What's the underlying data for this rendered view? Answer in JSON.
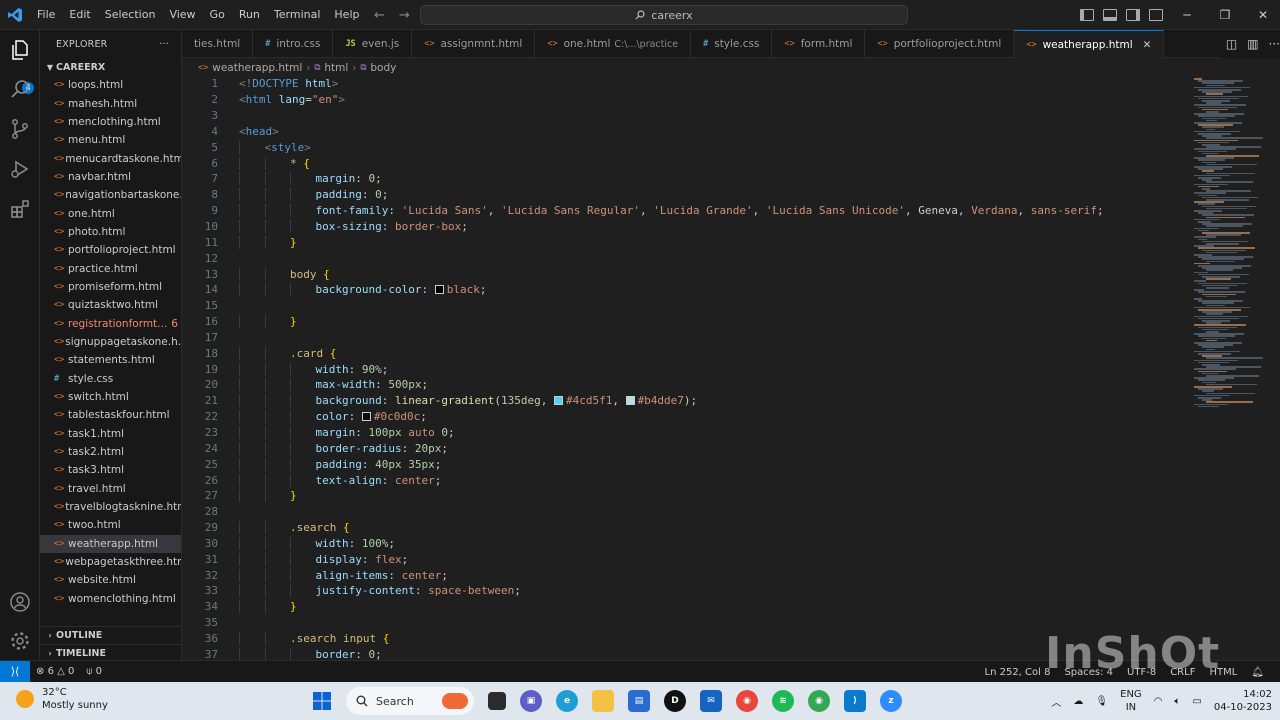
{
  "menu": [
    "File",
    "Edit",
    "Selection",
    "View",
    "Go",
    "Run",
    "Terminal",
    "Help"
  ],
  "command_center": "careerx",
  "explorer": {
    "title": "EXPLORER",
    "folder": "CAREERX",
    "files": [
      {
        "name": "loops.html",
        "type": "html"
      },
      {
        "name": "mahesh.html",
        "type": "html"
      },
      {
        "name": "menclothing.html",
        "type": "html"
      },
      {
        "name": "menu.html",
        "type": "html"
      },
      {
        "name": "menucardtaskone.html",
        "type": "html"
      },
      {
        "name": "navbar.html",
        "type": "html"
      },
      {
        "name": "navigationbartaskone....",
        "type": "html"
      },
      {
        "name": "one.html",
        "type": "html"
      },
      {
        "name": "photo.html",
        "type": "html"
      },
      {
        "name": "portfolioproject.html",
        "type": "html"
      },
      {
        "name": "practice.html",
        "type": "html"
      },
      {
        "name": "promiseform.html",
        "type": "html"
      },
      {
        "name": "quiztasktwo.html",
        "type": "html"
      },
      {
        "name": "registrationformt...",
        "type": "html",
        "errors": "6"
      },
      {
        "name": "signuppagetaskone.h...",
        "type": "html"
      },
      {
        "name": "statements.html",
        "type": "html"
      },
      {
        "name": "style.css",
        "type": "css"
      },
      {
        "name": "switch.html",
        "type": "html"
      },
      {
        "name": "tablestaskfour.html",
        "type": "html"
      },
      {
        "name": "task1.html",
        "type": "html"
      },
      {
        "name": "task2.html",
        "type": "html"
      },
      {
        "name": "task3.html",
        "type": "html"
      },
      {
        "name": "travel.html",
        "type": "html"
      },
      {
        "name": "travelblogtasknine.html",
        "type": "html"
      },
      {
        "name": "twoo.html",
        "type": "html"
      },
      {
        "name": "weatherapp.html",
        "type": "html",
        "active": true
      },
      {
        "name": "webpagetaskthree.html",
        "type": "html"
      },
      {
        "name": "website.html",
        "type": "html"
      },
      {
        "name": "womenclothing.html",
        "type": "html"
      }
    ],
    "outline": "OUTLINE",
    "timeline": "TIMELINE",
    "badge": "4"
  },
  "tabs": [
    {
      "label": "ties.html",
      "type": "none"
    },
    {
      "label": "intro.css",
      "type": "css"
    },
    {
      "label": "even.js",
      "type": "js"
    },
    {
      "label": "assignmnt.html",
      "type": "html"
    },
    {
      "label": "one.html",
      "type": "html",
      "desc": "C:\\...\\practice"
    },
    {
      "label": "style.css",
      "type": "css"
    },
    {
      "label": "form.html",
      "type": "html"
    },
    {
      "label": "portfolioproject.html",
      "type": "html"
    },
    {
      "label": "weatherapp.html",
      "type": "html",
      "active": true
    }
  ],
  "breadcrumb": [
    "weatherapp.html",
    "html",
    "body"
  ],
  "code": [
    {
      "n": "1",
      "i": 0,
      "t": [
        [
          "punc",
          "<!"
        ],
        [
          "tag",
          "DOCTYPE"
        ],
        [
          "txt",
          " "
        ],
        [
          "attr",
          "html"
        ],
        [
          "punc",
          ">"
        ]
      ]
    },
    {
      "n": "2",
      "i": 0,
      "t": [
        [
          "punc",
          "<"
        ],
        [
          "tag",
          "html"
        ],
        [
          "txt",
          " "
        ],
        [
          "attr",
          "lang"
        ],
        [
          "txt",
          "="
        ],
        [
          "str",
          "\"en\""
        ],
        [
          "punc",
          ">"
        ]
      ]
    },
    {
      "n": "3",
      "i": 0,
      "t": []
    },
    {
      "n": "4",
      "i": 0,
      "t": [
        [
          "punc",
          "<"
        ],
        [
          "tag",
          "head"
        ],
        [
          "punc",
          ">"
        ]
      ]
    },
    {
      "n": "5",
      "i": 1,
      "t": [
        [
          "punc",
          "<"
        ],
        [
          "tag",
          "style"
        ],
        [
          "punc",
          ">"
        ]
      ]
    },
    {
      "n": "6",
      "i": 2,
      "t": [
        [
          "sel",
          "* "
        ],
        [
          "brace",
          "{"
        ]
      ]
    },
    {
      "n": "7",
      "i": 3,
      "t": [
        [
          "prop",
          "margin"
        ],
        [
          "txt",
          ": "
        ],
        [
          "num",
          "0"
        ],
        [
          "txt",
          ";"
        ]
      ]
    },
    {
      "n": "8",
      "i": 3,
      "t": [
        [
          "prop",
          "padding"
        ],
        [
          "txt",
          ": "
        ],
        [
          "num",
          "0"
        ],
        [
          "txt",
          ";"
        ]
      ]
    },
    {
      "n": "9",
      "i": 3,
      "t": [
        [
          "prop",
          "font-family"
        ],
        [
          "txt",
          ": "
        ],
        [
          "str",
          "'Lucida Sans'"
        ],
        [
          "txt",
          ", "
        ],
        [
          "str",
          "'Lucida Sans Regular'"
        ],
        [
          "txt",
          ", "
        ],
        [
          "str",
          "'Lucida Grande'"
        ],
        [
          "txt",
          ", "
        ],
        [
          "str",
          "'Lucida Sans Unicode'"
        ],
        [
          "txt",
          ", Geneva, "
        ],
        [
          "val",
          "Verdana"
        ],
        [
          "txt",
          ", "
        ],
        [
          "val",
          "sans-serif"
        ],
        [
          "txt",
          ";"
        ]
      ]
    },
    {
      "n": "10",
      "i": 3,
      "t": [
        [
          "prop",
          "box-sizing"
        ],
        [
          "txt",
          ": "
        ],
        [
          "val",
          "border-box"
        ],
        [
          "txt",
          ";"
        ]
      ]
    },
    {
      "n": "11",
      "i": 2,
      "t": [
        [
          "brace",
          "}"
        ]
      ]
    },
    {
      "n": "12",
      "i": 0,
      "t": []
    },
    {
      "n": "13",
      "i": 2,
      "t": [
        [
          "sel",
          "body "
        ],
        [
          "brace",
          "{"
        ]
      ]
    },
    {
      "n": "14",
      "i": 3,
      "t": [
        [
          "prop",
          "background-color"
        ],
        [
          "txt",
          ": "
        ],
        [
          "swatch",
          "#000000"
        ],
        [
          "val",
          "black"
        ],
        [
          "txt",
          ";"
        ]
      ]
    },
    {
      "n": "15",
      "i": 0,
      "t": []
    },
    {
      "n": "16",
      "i": 2,
      "t": [
        [
          "brace",
          "}"
        ]
      ]
    },
    {
      "n": "17",
      "i": 0,
      "t": []
    },
    {
      "n": "18",
      "i": 2,
      "t": [
        [
          "sel",
          ".card "
        ],
        [
          "brace",
          "{"
        ]
      ]
    },
    {
      "n": "19",
      "i": 3,
      "t": [
        [
          "prop",
          "width"
        ],
        [
          "txt",
          ": "
        ],
        [
          "num",
          "90%"
        ],
        [
          "txt",
          ";"
        ]
      ]
    },
    {
      "n": "20",
      "i": 3,
      "t": [
        [
          "prop",
          "max-width"
        ],
        [
          "txt",
          ": "
        ],
        [
          "num",
          "500px"
        ],
        [
          "txt",
          ";"
        ]
      ]
    },
    {
      "n": "21",
      "i": 3,
      "t": [
        [
          "prop",
          "background"
        ],
        [
          "txt",
          ": "
        ],
        [
          "fn",
          "linear-gradient"
        ],
        [
          "txt",
          "("
        ],
        [
          "num",
          "135deg"
        ],
        [
          "txt",
          ", "
        ],
        [
          "swatch",
          "#4cd5f1"
        ],
        [
          "val",
          "#4cd5f1"
        ],
        [
          "txt",
          ", "
        ],
        [
          "swatch",
          "#b4dde7"
        ],
        [
          "val",
          "#b4dde7"
        ],
        [
          "txt",
          ");"
        ]
      ]
    },
    {
      "n": "22",
      "i": 3,
      "t": [
        [
          "prop",
          "color"
        ],
        [
          "txt",
          ": "
        ],
        [
          "swatch",
          "#0c0d0c"
        ],
        [
          "val",
          "#0c0d0c"
        ],
        [
          "txt",
          ";"
        ]
      ]
    },
    {
      "n": "23",
      "i": 3,
      "t": [
        [
          "prop",
          "margin"
        ],
        [
          "txt",
          ": "
        ],
        [
          "num",
          "100px"
        ],
        [
          "txt",
          " "
        ],
        [
          "val",
          "auto"
        ],
        [
          "txt",
          " "
        ],
        [
          "num",
          "0"
        ],
        [
          "txt",
          ";"
        ]
      ]
    },
    {
      "n": "24",
      "i": 3,
      "t": [
        [
          "prop",
          "border-radius"
        ],
        [
          "txt",
          ": "
        ],
        [
          "num",
          "20px"
        ],
        [
          "txt",
          ";"
        ]
      ]
    },
    {
      "n": "25",
      "i": 3,
      "t": [
        [
          "prop",
          "padding"
        ],
        [
          "txt",
          ": "
        ],
        [
          "num",
          "40px"
        ],
        [
          "txt",
          " "
        ],
        [
          "num",
          "35px"
        ],
        [
          "txt",
          ";"
        ]
      ]
    },
    {
      "n": "26",
      "i": 3,
      "t": [
        [
          "prop",
          "text-align"
        ],
        [
          "txt",
          ": "
        ],
        [
          "val",
          "center"
        ],
        [
          "txt",
          ";"
        ]
      ]
    },
    {
      "n": "27",
      "i": 2,
      "t": [
        [
          "brace",
          "}"
        ]
      ]
    },
    {
      "n": "28",
      "i": 0,
      "t": []
    },
    {
      "n": "29",
      "i": 2,
      "t": [
        [
          "sel",
          ".search "
        ],
        [
          "brace",
          "{"
        ]
      ]
    },
    {
      "n": "30",
      "i": 3,
      "t": [
        [
          "prop",
          "width"
        ],
        [
          "txt",
          ": "
        ],
        [
          "num",
          "100%"
        ],
        [
          "txt",
          ";"
        ]
      ]
    },
    {
      "n": "31",
      "i": 3,
      "t": [
        [
          "prop",
          "display"
        ],
        [
          "txt",
          ": "
        ],
        [
          "val",
          "flex"
        ],
        [
          "txt",
          ";"
        ]
      ]
    },
    {
      "n": "32",
      "i": 3,
      "t": [
        [
          "prop",
          "align-items"
        ],
        [
          "txt",
          ": "
        ],
        [
          "val",
          "center"
        ],
        [
          "txt",
          ";"
        ]
      ]
    },
    {
      "n": "33",
      "i": 3,
      "t": [
        [
          "prop",
          "justify-content"
        ],
        [
          "txt",
          ": "
        ],
        [
          "val",
          "space-between"
        ],
        [
          "txt",
          ";"
        ]
      ]
    },
    {
      "n": "34",
      "i": 2,
      "t": [
        [
          "brace",
          "}"
        ]
      ]
    },
    {
      "n": "35",
      "i": 0,
      "t": []
    },
    {
      "n": "36",
      "i": 2,
      "t": [
        [
          "sel",
          ".search input "
        ],
        [
          "brace",
          "{"
        ]
      ]
    },
    {
      "n": "37",
      "i": 3,
      "t": [
        [
          "prop",
          "border"
        ],
        [
          "txt",
          ": "
        ],
        [
          "num",
          "0"
        ],
        [
          "txt",
          ";"
        ]
      ]
    }
  ],
  "status": {
    "errors": "6",
    "warnings": "0",
    "ports": "0",
    "position": "Ln 252, Col 8",
    "spaces": "Spaces: 4",
    "encoding": "UTF-8",
    "eol": "CRLF",
    "language": "HTML"
  },
  "watermark": "InShOt",
  "taskbar": {
    "temp": "32°C",
    "condition": "Mostly sunny",
    "search": "Search",
    "lang1": "ENG",
    "lang2": "IN",
    "time": "14:02",
    "date": "04-10-2023"
  },
  "colors": {
    "accent": "#0078d4",
    "editor_bg": "#1f1f1f",
    "sidebar_bg": "#181818",
    "taskbar_bg": "#dfe6ee"
  }
}
